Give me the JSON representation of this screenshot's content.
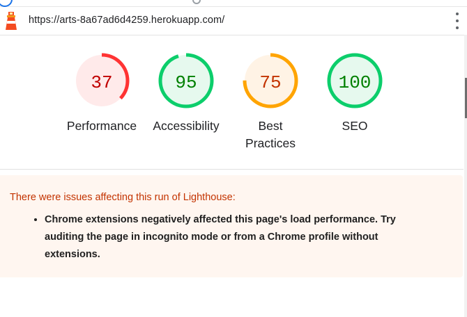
{
  "browser": {
    "url": "https://arts-8a67ad6d4259.herokuapp.com/",
    "logo_icon": "lighthouse-icon",
    "menu_icon": "kebab-menu-icon"
  },
  "scores": [
    {
      "label": "Performance",
      "value": "37",
      "score": 0.37,
      "status": "fail",
      "color": "#ff3333",
      "text_color": "#c00000",
      "fill": "#ffeaea"
    },
    {
      "label": "Accessibility",
      "value": "95",
      "score": 0.95,
      "status": "pass",
      "color": "#0cce6b",
      "text_color": "#008000",
      "fill": "#e6f9ee"
    },
    {
      "label": "Best Practices",
      "value": "75",
      "score": 0.75,
      "status": "average",
      "color": "#ffa400",
      "text_color": "#c33300",
      "fill": "#fff3e5"
    },
    {
      "label": "SEO",
      "value": "100",
      "score": 1.0,
      "status": "pass",
      "color": "#0cce6b",
      "text_color": "#008000",
      "fill": "#e6f9ee"
    }
  ],
  "warning": {
    "title": "There were issues affecting this run of Lighthouse:",
    "items": [
      "Chrome extensions negatively affected this page's load performance. Try auditing the page in incognito mode or from a Chrome profile without extensions."
    ]
  }
}
